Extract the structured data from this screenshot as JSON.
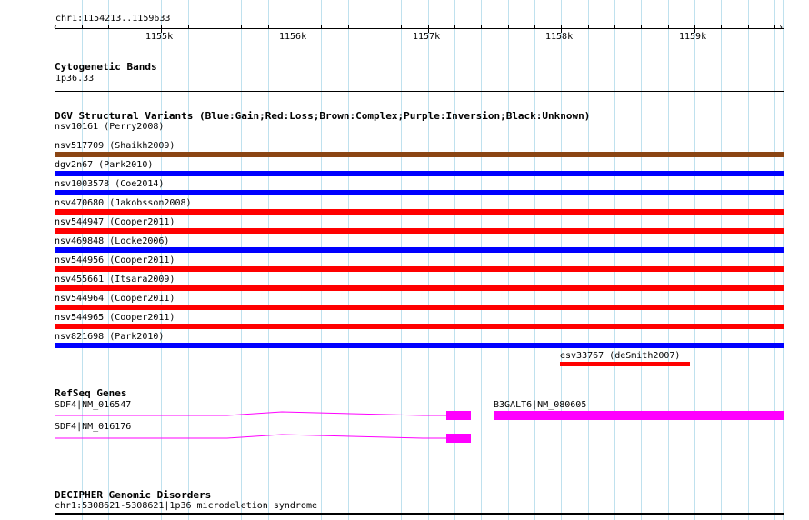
{
  "ruler": {
    "location": "chr1:1154213..1159633",
    "ticks": [
      "1155k",
      "1156k",
      "1157k",
      "1158k",
      "1159k"
    ]
  },
  "cytoband": {
    "title": "Cytogenetic Bands",
    "label": "1p36.33"
  },
  "dgv": {
    "title": "DGV Structural Variants (Blue:Gain;Red:Loss;Brown:Complex;Purple:Inversion;Black:Unknown)",
    "variants": [
      {
        "label": "nsv10161 (Perry2008)",
        "color": "#8b4513"
      },
      {
        "label": "nsv517709 (Shaikh2009)",
        "color": "#8b4513"
      },
      {
        "label": "dgv2n67 (Park2010)",
        "color": "#0000ff"
      },
      {
        "label": "nsv1003578 (Coe2014)",
        "color": "#0000ff"
      },
      {
        "label": "nsv470680 (Jakobsson2008)",
        "color": "#ff0000"
      },
      {
        "label": "nsv544947 (Cooper2011)",
        "color": "#ff0000"
      },
      {
        "label": "nsv469848 (Locke2006)",
        "color": "#0000ff"
      },
      {
        "label": "nsv544956 (Cooper2011)",
        "color": "#ff0000"
      },
      {
        "label": "nsv455661 (Itsara2009)",
        "color": "#ff0000"
      },
      {
        "label": "nsv544964 (Cooper2011)",
        "color": "#ff0000"
      },
      {
        "label": "nsv544965 (Cooper2011)",
        "color": "#ff0000"
      },
      {
        "label": "nsv821698 (Park2010)",
        "color": "#0000ff"
      },
      {
        "label": "esv33767 (deSmith2007)",
        "color": "#ff0000"
      }
    ]
  },
  "refseq": {
    "title": "RefSeq Genes",
    "genes": [
      {
        "label": "SDF4|NM_016547",
        "color": "#ff00ff"
      },
      {
        "label": "SDF4|NM_016176",
        "color": "#ff00ff"
      },
      {
        "label": "B3GALT6|NM_080605",
        "color": "#ff00ff"
      }
    ]
  },
  "decipher": {
    "title": "DECIPHER Genomic Disorders",
    "label": "chr1:5308621-5308621|1p36 microdeletion syndrome"
  }
}
